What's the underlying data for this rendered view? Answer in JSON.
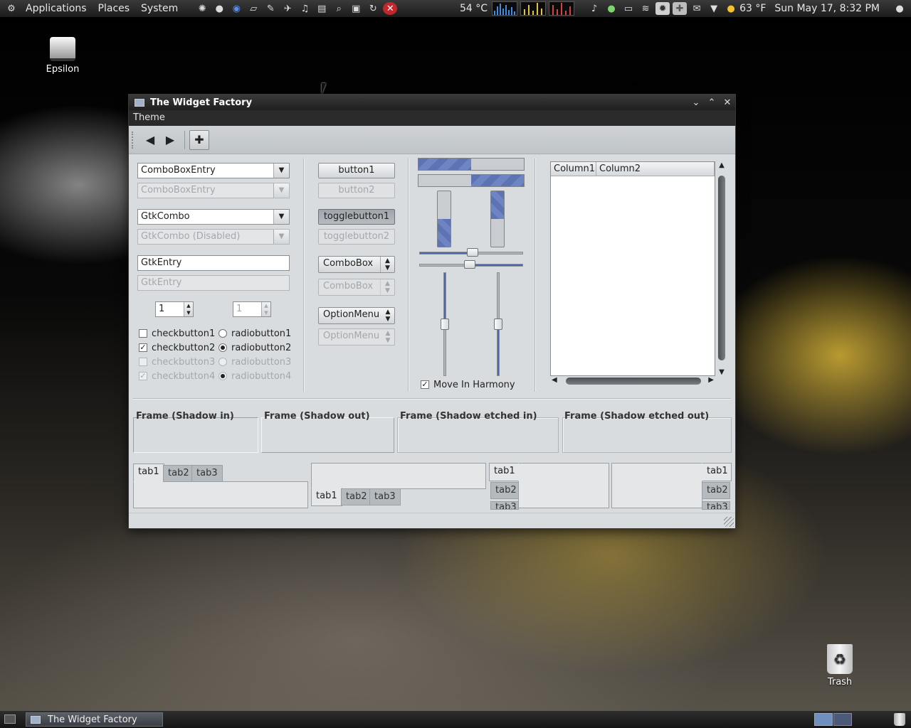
{
  "top_panel": {
    "menus": [
      "Applications",
      "Places",
      "System"
    ],
    "launcher_icons": [
      "distro-logo-icon",
      "gimp-icon",
      "web-browser-icon",
      "text-editor-icon",
      "pen-tool-icon",
      "bird-icon",
      "music-player-icon",
      "terminal-icon",
      "search-icon",
      "screenshot-icon",
      "refresh-icon",
      "close-app-icon"
    ],
    "cpu_temp": "54 °C",
    "weather": "63 °F",
    "datetime": "Sun May 17,  8:32 PM"
  },
  "desktop": {
    "drive_label": "Epsilon",
    "trash_label": "Trash"
  },
  "window": {
    "title": "The Widget Factory",
    "menu_theme": "Theme",
    "combo_entry": "ComboBoxEntry",
    "combo_entry_disabled": "ComboBoxEntry",
    "gtk_combo": "GtkCombo",
    "gtk_combo_disabled": "GtkCombo (Disabled)",
    "entry": "GtkEntry",
    "entry_disabled": "GtkEntry",
    "spin_value": "1",
    "spin_value_disabled": "1",
    "checks": [
      "checkbutton1",
      "checkbutton2",
      "checkbutton3",
      "checkbutton4"
    ],
    "radios": [
      "radiobutton1",
      "radiobutton2",
      "radiobutton3",
      "radiobutton4"
    ],
    "button1": "button1",
    "button2": "button2",
    "toggle1": "togglebutton1",
    "toggle2": "togglebutton2",
    "combobox": "ComboBox",
    "combobox_disabled": "ComboBox",
    "optionmenu": "OptionMenu",
    "optionmenu_disabled": "OptionMenu",
    "progress_h1": 0.5,
    "progress_h2": 0.5,
    "scale_h1": 0.5,
    "scale_h2": 0.5,
    "harmony_label": "Move In Harmony",
    "columns": [
      "Column1",
      "Column2"
    ],
    "frames": [
      "Frame (Shadow in)",
      "Frame (Shadow out)",
      "Frame (Shadow etched in)",
      "Frame (Shadow etched out)"
    ],
    "tabs": [
      "tab1",
      "tab2",
      "tab3"
    ]
  },
  "bottom_panel": {
    "task": "The Widget Factory"
  },
  "colors": {
    "accent": "#5d73b4",
    "window_bg": "#d9dcde",
    "panel": "#2a2a2a"
  }
}
